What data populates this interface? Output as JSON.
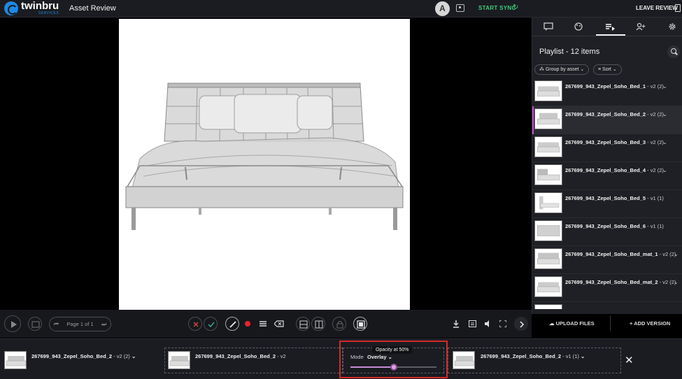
{
  "header": {
    "logo_text": "twinbru",
    "logo_sub": "SERVICES",
    "title": "Asset Review",
    "avatar_initial": "A",
    "start_sync": "START SYNC",
    "leave_review": "LEAVE REVIEW"
  },
  "panel": {
    "title": "Playlist - 12 items",
    "group_by": "Group by asset",
    "sort": "Sort",
    "items": [
      {
        "name": "267699_943_Zepel_Soho_Bed_1",
        "version": " - v2 (2)",
        "selected": false
      },
      {
        "name": "267699_943_Zepel_Soho_Bed_2",
        "version": " - v2 (2)",
        "selected": true
      },
      {
        "name": "267699_943_Zepel_Soho_Bed_3",
        "version": " - v2 (2)",
        "selected": false
      },
      {
        "name": "267699_943_Zepel_Soho_Bed_4",
        "version": " - v2 (2)",
        "selected": false
      },
      {
        "name": "267699_943_Zepel_Soho_Bed_5",
        "version": " - v1 (1)",
        "selected": false
      },
      {
        "name": "267699_943_Zepel_Soho_Bed_6",
        "version": " - v1 (1)",
        "selected": false
      },
      {
        "name": "267699_943_Zepel_Soho_Bed_mat_1",
        "version": " - v2 (2)",
        "selected": false
      },
      {
        "name": "267699_943_Zepel_Soho_Bed_mat_2",
        "version": " - v2 (2)",
        "selected": false
      }
    ],
    "upload": "UPLOAD FILES",
    "add_version": "ADD VERSION"
  },
  "toolbar": {
    "page_indicator": "Page 1 of 1"
  },
  "compare": {
    "left_asset": "267699_943_Zepel_Soho_Bed_2",
    "left_version": " - v2 (2)",
    "a_asset": "267699_943_Zepel_Soho_Bed_2",
    "a_version": " - v2",
    "mode_label": "Mode",
    "mode_value": "Overlay",
    "tooltip": "Opacity at 50%",
    "opacity": 0.5,
    "b_asset": "267699_943_Zepel_Soho_Bed_2",
    "b_version": " - v1 (1)"
  },
  "colors": {
    "accent_green": "#3ecf7a",
    "selection_purple": "#c24ed6",
    "record_red": "#e8232f",
    "highlight_red": "#d42a2a"
  }
}
